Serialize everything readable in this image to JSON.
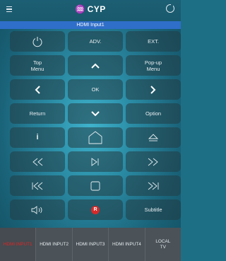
{
  "header": {
    "brand": "CYP",
    "brand_mark": "♒",
    "menu_icon": "hamburger-menu-icon",
    "power_icon": "power-icon"
  },
  "input_bar": {
    "label": "HDMI Input1"
  },
  "remote": {
    "adv_label": "ADV.",
    "ext_label": "EXT.",
    "top_menu_label": "Top\nMenu",
    "popup_menu_label": "Pop-up\nMenu",
    "ok_label": "OK",
    "return_label": "Return",
    "option_label": "Option",
    "info_label": "i",
    "subtitle_label": "Subtitle",
    "record_label": "R"
  },
  "tabs": [
    {
      "label": "HDMI INPUT1",
      "active": true
    },
    {
      "label": "HDMI INPUT2",
      "active": false
    },
    {
      "label": "HDMI INPUT3",
      "active": false
    },
    {
      "label": "HDMI INPUT4",
      "active": false
    },
    {
      "label": "LOCAL\nTV",
      "active": false
    }
  ],
  "colors": {
    "accent_active_tab": "#e02424",
    "input_bar": "#2f6ec9",
    "record_button": "#d42a2a"
  }
}
